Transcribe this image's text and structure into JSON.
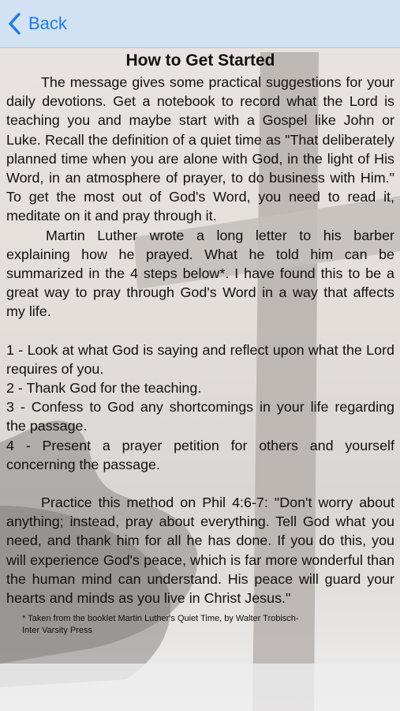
{
  "nav": {
    "back_label": "Back"
  },
  "page": {
    "title": "How to Get Started",
    "paragraph1": "The message gives some practical suggestions for your daily devotions. Get a notebook to record what the Lord is teaching you and maybe start with a Gospel like John or Luke.  Recall the definition of a quiet time as \"That deliberately planned time when you are alone with God, in the light of His Word, in an atmosphere of prayer, to do business with Him.\" To get the most out of God's Word, you need to read it, meditate on it and pray through it.",
    "paragraph2": "Martin Luther wrote a long letter to his barber explaining how he prayed.  What he told him can be summarized in the 4 steps below*.  I have found this to be a great way to pray through God's Word in a way that affects my life.",
    "steps": [
      "1 - Look at what God is saying and reflect upon what the Lord requires of you.",
      "2 - Thank God for the teaching.",
      "3 - Confess to God any shortcomings in your life regarding the passage.",
      "4 - Present a prayer petition for others and yourself concerning the passage."
    ],
    "paragraph3": "Practice this method on Phil 4:6-7: \"Don't worry about anything; instead, pray about everything. Tell God what you need, and thank him for all he has done.  If you do this, you will experience God's peace, which is far more wonderful than the human mind can understand. His peace will guard your hearts and minds as you live in Christ Jesus.\"",
    "footnote_line1": "* Taken from the booklet Martin Luther's Quiet Time, by Walter Trobisch-",
    "footnote_line2": "Inter Varsity Press"
  },
  "colors": {
    "navbar_bg": "#d2e2f3",
    "accent": "#1a7cf0",
    "text": "#111111"
  },
  "icons": {
    "back": "chevron-left-icon"
  }
}
